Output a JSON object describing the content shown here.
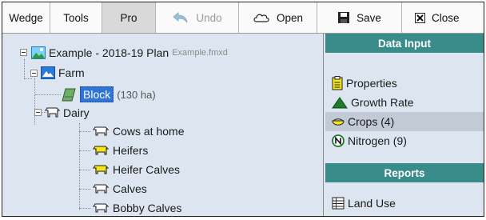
{
  "toolbar": {
    "wedge_label": "Wedge",
    "tools_label": "Tools",
    "pro_label": "Pro",
    "undo_label": "Undo",
    "open_label": "Open",
    "save_label": "Save",
    "close_label": "Close"
  },
  "tree": {
    "root": {
      "label": "Example - 2018-19 Plan",
      "filename": "Example.fmxd"
    },
    "farm": {
      "label": "Farm"
    },
    "block": {
      "label": "Block",
      "area": "(130 ha)"
    },
    "dairy": {
      "label": "Dairy"
    },
    "groups": [
      {
        "label": "Cows at home",
        "icon_color": "#ffffff"
      },
      {
        "label": "Heifers",
        "icon_color": "#f5e61c"
      },
      {
        "label": "Heifer Calves",
        "icon_color": "#f5e61c"
      },
      {
        "label": "Calves",
        "icon_color": "#ffffff"
      },
      {
        "label": "Bobby Calves",
        "icon_color": "#ffffff"
      }
    ]
  },
  "side": {
    "data_input_header": "Data Input",
    "data_input_items": [
      {
        "label": "Properties",
        "icon": "clipboard-icon"
      },
      {
        "label": "Growth Rate",
        "icon": "triangle-growth-icon"
      },
      {
        "label": "Crops (4)",
        "icon": "crop-bowl-icon"
      },
      {
        "label": "Nitrogen (9)",
        "icon": "nitrogen-icon"
      }
    ],
    "reports_header": "Reports",
    "reports_items": [
      {
        "label": "Land Use",
        "icon": "report-table-icon"
      }
    ]
  },
  "colors": {
    "header_teal": "#3a8c8a",
    "panel_bg": "#dde6f0",
    "selection_blue": "#3074d8",
    "selected_row": "#c2cad6"
  }
}
